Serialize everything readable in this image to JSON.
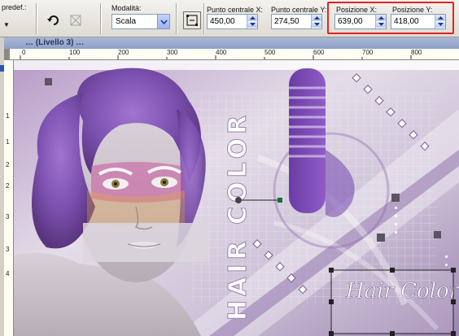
{
  "toolbar": {
    "preset_label": "predef.:",
    "mode_label": "Modalità:",
    "mode_value": "Scala",
    "center_x_label": "Punto centrale X:",
    "center_x_value": "450,00",
    "center_y_label": "Punto centrale Y:",
    "center_y_value": "274,50",
    "pos_x_label": "Posizione X:",
    "pos_x_value": "639,00",
    "pos_y_label": "Posizione Y:",
    "pos_y_value": "418,00",
    "highlight_color": "#e02424"
  },
  "document": {
    "title": "… (Livello 3) …"
  },
  "rulers": {
    "top_ticks": [
      "0",
      "100",
      "200",
      "300",
      "400",
      "500",
      "600",
      "700",
      "800"
    ],
    "left_ticks": [
      "1",
      "1",
      "2",
      "2",
      "3",
      "3",
      "4"
    ]
  },
  "canvas": {
    "vertical_text": "HAIR COLOR",
    "signature_text": "Hair Color"
  },
  "icons": {
    "preset_arrow": "chevron-down-icon",
    "reset": "rotate-arrow-icon",
    "free": "transform-icon",
    "mode_dropdown": "chevron-down-icon",
    "node": "node-icon"
  }
}
